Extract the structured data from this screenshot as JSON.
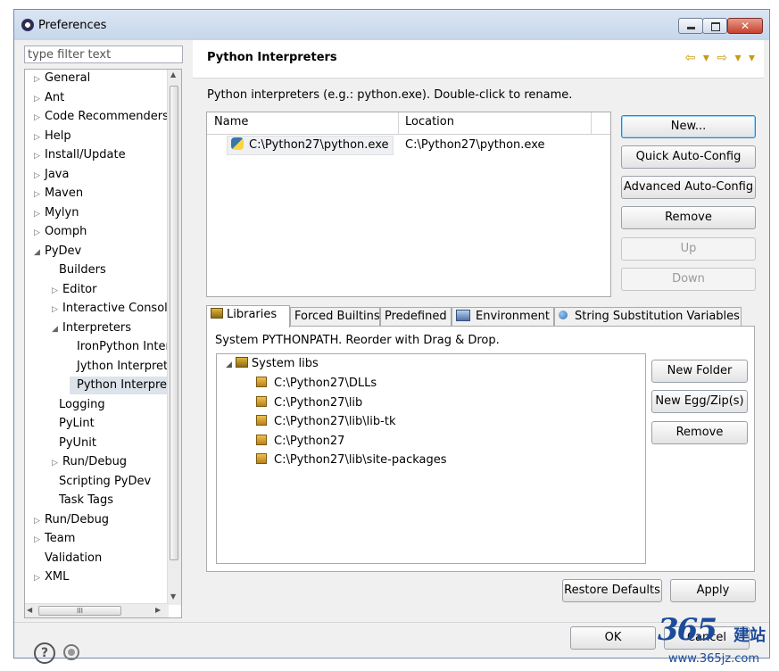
{
  "window": {
    "title": "Preferences",
    "close_glyph": "✕"
  },
  "filter": {
    "placeholder": "type filter text"
  },
  "tree": {
    "items": [
      {
        "label": "General",
        "arrow": "▷"
      },
      {
        "label": "Ant",
        "arrow": "▷"
      },
      {
        "label": "Code Recommenders",
        "arrow": "▷"
      },
      {
        "label": "Help",
        "arrow": "▷"
      },
      {
        "label": "Install/Update",
        "arrow": "▷"
      },
      {
        "label": "Java",
        "arrow": "▷"
      },
      {
        "label": "Maven",
        "arrow": "▷"
      },
      {
        "label": "Mylyn",
        "arrow": "▷"
      },
      {
        "label": "Oomph",
        "arrow": "▷"
      },
      {
        "label": "PyDev",
        "arrow": "◢"
      },
      {
        "label": "Builders",
        "arrow": ""
      },
      {
        "label": "Editor",
        "arrow": "▷"
      },
      {
        "label": "Interactive Console",
        "arrow": "▷"
      },
      {
        "label": "Interpreters",
        "arrow": "◢"
      },
      {
        "label": "IronPython Interpreter",
        "arrow": ""
      },
      {
        "label": "Jython Interpreter",
        "arrow": ""
      },
      {
        "label": "Python Interpreter",
        "arrow": ""
      },
      {
        "label": "Logging",
        "arrow": ""
      },
      {
        "label": "PyLint",
        "arrow": ""
      },
      {
        "label": "PyUnit",
        "arrow": ""
      },
      {
        "label": "Run/Debug",
        "arrow": "▷"
      },
      {
        "label": "Scripting PyDev",
        "arrow": ""
      },
      {
        "label": "Task Tags",
        "arrow": ""
      },
      {
        "label": "Run/Debug",
        "arrow": "▷"
      },
      {
        "label": "Team",
        "arrow": "▷"
      },
      {
        "label": "Validation",
        "arrow": ""
      },
      {
        "label": "XML",
        "arrow": "▷"
      }
    ],
    "scroll_up": "▲",
    "scroll_down": "▼",
    "scroll_left": "◀",
    "scroll_right": "▶",
    "hthumb_grip": "III"
  },
  "page": {
    "title": "Python Interpreters",
    "nav": "⇦ ▾ ⇨ ▾ ▾",
    "description": "Python interpreters (e.g.: python.exe).   Double-click to rename.",
    "columns": [
      "Name",
      "Location"
    ],
    "interpreters": [
      {
        "name": "C:\\Python27\\python.exe",
        "location": "C:\\Python27\\python.exe"
      }
    ],
    "buttons": {
      "new": "New...",
      "quick": "Quick Auto-Config",
      "advanced": "Advanced Auto-Config",
      "remove": "Remove",
      "up": "Up",
      "down": "Down"
    },
    "tabs": [
      "Libraries",
      "Forced Builtins",
      "Predefined",
      "Environment",
      "String Substitution Variables"
    ],
    "libraries": {
      "description": "System PYTHONPATH.   Reorder with Drag & Drop.",
      "root": "System libs",
      "root_arrow": "◢",
      "paths": [
        "C:\\Python27\\DLLs",
        "C:\\Python27\\lib",
        "C:\\Python27\\lib\\lib-tk",
        "C:\\Python27",
        "C:\\Python27\\lib\\site-packages"
      ],
      "buttons": {
        "new_folder": "New Folder",
        "new_egg": "New Egg/Zip(s)",
        "remove": "Remove"
      }
    },
    "restore_defaults": "Restore Defaults",
    "apply": "Apply"
  },
  "footer": {
    "help_glyph": "?",
    "ok": "OK",
    "cancel": "Cancel"
  },
  "watermark": {
    "logo": "365",
    "cn": "建站",
    "url": "www.365jz.com"
  }
}
